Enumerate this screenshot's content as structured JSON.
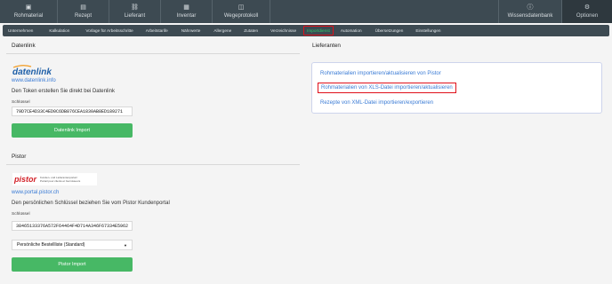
{
  "topnav": {
    "items": [
      {
        "label": "Rohmaterial",
        "icon": "box-icon"
      },
      {
        "label": "Rezept",
        "icon": "recipe-book-icon"
      },
      {
        "label": "Lieferant",
        "icon": "truck-icon"
      },
      {
        "label": "Inventar",
        "icon": "grid-icon"
      },
      {
        "label": "Wegeprotokoll",
        "icon": "clipboard-icon"
      }
    ],
    "right_items": [
      {
        "label": "Wissensdatenbank",
        "icon": "info-icon"
      },
      {
        "label": "Optionen",
        "icon": "gear-icon"
      }
    ]
  },
  "subnav": {
    "items": [
      "Unternehmen",
      "Kalkulation",
      "Vorlage für Arbeitsschritte",
      "Arbeitstarife",
      "Nährwerte",
      "Allergene",
      "Zutaten",
      "Verzeichnisse",
      "Importdienst",
      "Automation",
      "Übersetzungen",
      "Einstellungen"
    ],
    "active": "Importdienst"
  },
  "datenlink": {
    "section_title": "Datenlink",
    "logo_text": "datenlink",
    "url": "www.datenlink.info",
    "description": "Den Token erstellen Sie direkt bei Datenlink",
    "key_label": "Schlüssel",
    "key_value": "79D7CE4D33C4ED0C6DB876CEA1830AB8ED189271",
    "import_button": "Datenlink Import"
  },
  "pistor": {
    "section_title": "Pistor",
    "logo_text": "pistor",
    "logo_tagline_1": "Kunden- und Lieferantenportal /",
    "logo_tagline_2": "Portail pour clients et fournisseurs",
    "url": "www.portal.pistor.ch",
    "description": "Den persönlichen Schlüssel beziehen Sie vom Pistor Kundenportal",
    "key_label": "Schlüssel",
    "key_value": "38465133376A572F64464F4D714A346F67334E5962",
    "select_value": "Persönliche Bestellliste (Standard)",
    "import_button": "Pistor Import"
  },
  "lieferanten": {
    "section_title": "Lieferanten",
    "items": [
      "Rohmaterialien importieren/aktualisieren von Pistor",
      "Rohmaterialien von XLS-Datei importieren/aktualisieren",
      "Rezepte von XML-Datei importieren/exportieren"
    ]
  },
  "colors": {
    "nav_bg": "#3d4a52",
    "accent_green": "#47b865",
    "link_blue": "#3a7bd5",
    "highlight_red": "#e0101a"
  }
}
